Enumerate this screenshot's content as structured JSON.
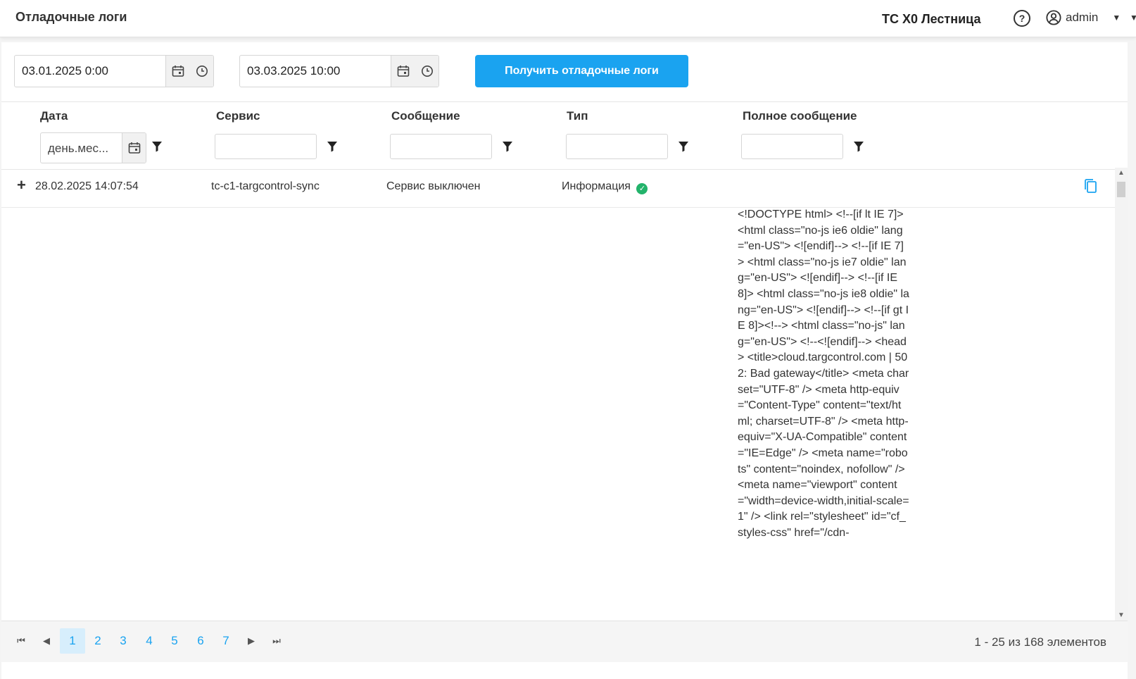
{
  "header": {
    "title": "Отладочные логи",
    "tenant": "ТС Х0 Лестница",
    "help_label": "?",
    "user_name": "admin"
  },
  "toolbar": {
    "from_value": "03.01.2025 0:00",
    "to_value": "03.03.2025 10:00",
    "fetch_label": "Получить отладочные логи"
  },
  "grid": {
    "columns": [
      "Дата",
      "Сервис",
      "Сообщение",
      "Тип",
      "Полное сообщение"
    ],
    "date_filter_placeholder": "день.мес...",
    "rows": [
      {
        "expand": "+",
        "date": "28.02.2025 14:07:54",
        "service": "tc-c1-targcontrol-sync",
        "message": "Сервис выключен",
        "type": "Информация",
        "full_message": "<!DOCTYPE html> <!--[if lt IE 7]> <html class=\"no-js ie6 oldie\" lang=\"en-US\"> <![endif]--> <!--[if IE 7]> <html class=\"no-js ie7 oldie\" lang=\"en-US\"> <![endif]--> <!--[if IE 8]> <html class=\"no-js ie8 oldie\" lang=\"en-US\"> <![endif]--> <!--[if gt IE 8]><!--> <html class=\"no-js\" lang=\"en-US\"> <!--<![endif]--> <head> <title>cloud.targcontrol.com | 502: Bad gateway</title> <meta charset=\"UTF-8\" /> <meta http-equiv=\"Content-Type\" content=\"text/html; charset=UTF-8\" /> <meta http-equiv=\"X-UA-Compatible\" content=\"IE=Edge\" /> <meta name=\"robots\" content=\"noindex, nofollow\" /> <meta name=\"viewport\" content=\"width=device-width,initial-scale=1\" /> <link rel=\"stylesheet\" id=\"cf_styles-css\" href=\"/cdn-"
      }
    ]
  },
  "pager": {
    "pages": [
      "1",
      "2",
      "3",
      "4",
      "5",
      "6",
      "7"
    ],
    "current_page": "1",
    "info": "1 - 25 из 168 элементов"
  },
  "colors": {
    "accent": "#1aa3f0",
    "success": "#23b36b"
  }
}
